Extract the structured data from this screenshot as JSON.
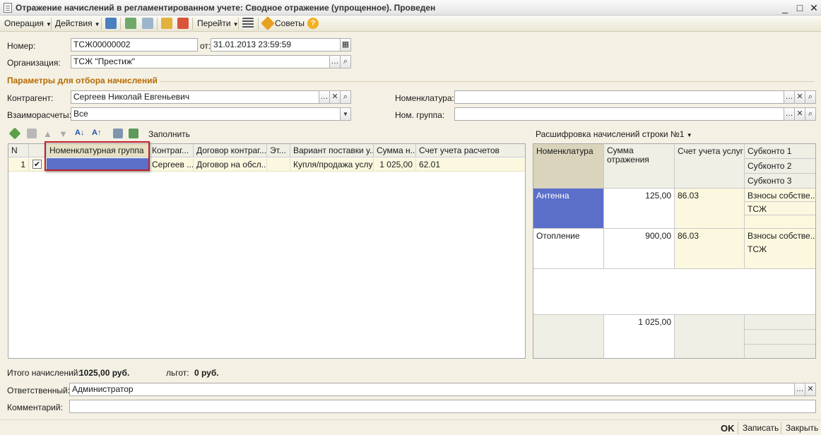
{
  "window": {
    "title": "Отражение начислений в регламентированном учете: Сводное отражение (упрощенное). Проведен",
    "minimize": "_",
    "maximize": "□",
    "close": "✕"
  },
  "toolbar": {
    "operation": "Операция",
    "actions": "Действия",
    "goto": "Перейти",
    "tips": "Советы"
  },
  "header": {
    "number_label": "Номер:",
    "number_value": "ТСЖ00000002",
    "date_label": "от:",
    "date_value": "31.01.2013 23:59:59",
    "org_label": "Организация:",
    "org_value": "ТСЖ \"Престиж\""
  },
  "filters": {
    "section_title": "Параметры для отбора начислений",
    "contractor_label": "Контрагент:",
    "contractor_value": "Сергеев Николай Евгеньевич",
    "settlements_label": "Взаиморасчеты:",
    "settlements_value": "Все",
    "nomenclature_label": "Номенклатура:",
    "nomenclature_value": "",
    "nom_group_label": "Ном. группа:",
    "nom_group_value": ""
  },
  "main_table": {
    "fill_label": "Заполнить",
    "columns": [
      "N",
      "",
      "Номенклатурная группа",
      "Контраг...",
      "Договор контраг...",
      "Эт...",
      "Вариант поставки у...",
      "Сумма н...",
      "Счет учета расчетов"
    ],
    "rows": [
      {
        "n": "1",
        "checked": "✔",
        "group": "",
        "contractor": "Сергеев ...",
        "contract": "Договор на обсл...",
        "stage": "",
        "variant": "Купля/продажа услуг",
        "sum": "1 025,00",
        "account": "62.01"
      }
    ]
  },
  "detail": {
    "title": "Расшифровка начислений строки №1",
    "headers": {
      "nomenclature": "Номенклатура",
      "sum": "Сумма отражения",
      "account": "Счет учета услуг",
      "sub1": "Субконто 1",
      "sub2": "Субконто 2",
      "sub3": "Субконто 3"
    },
    "rows": [
      {
        "nomenclature": "Антенна",
        "sum": "125,00",
        "account": "86.03",
        "sub1": "Взносы собстве...",
        "sub2": "ТСЖ",
        "sub3": ""
      },
      {
        "nomenclature": "Отопление",
        "sum": "900,00",
        "account": "86.03",
        "sub1": "Взносы собстве...",
        "sub2": "ТСЖ",
        "sub3": ""
      }
    ],
    "total_sum": "1 025,00"
  },
  "totals": {
    "accrued_label": "Итого начислений:",
    "accrued_value": "1025,00 руб.",
    "benefits_label": "льгот:",
    "benefits_value": "0 руб."
  },
  "footer": {
    "responsible_label": "Ответственный:",
    "responsible_value": "Администратор",
    "comment_label": "Комментарий:",
    "comment_value": "",
    "ok": "OK",
    "save": "Записать",
    "close": "Закрыть"
  },
  "colors": {
    "accent_orange": "#b56a00",
    "selection_blue": "#5b6fc9",
    "highlight_red": "#c0202a",
    "row_yellow": "#fbf8df"
  }
}
